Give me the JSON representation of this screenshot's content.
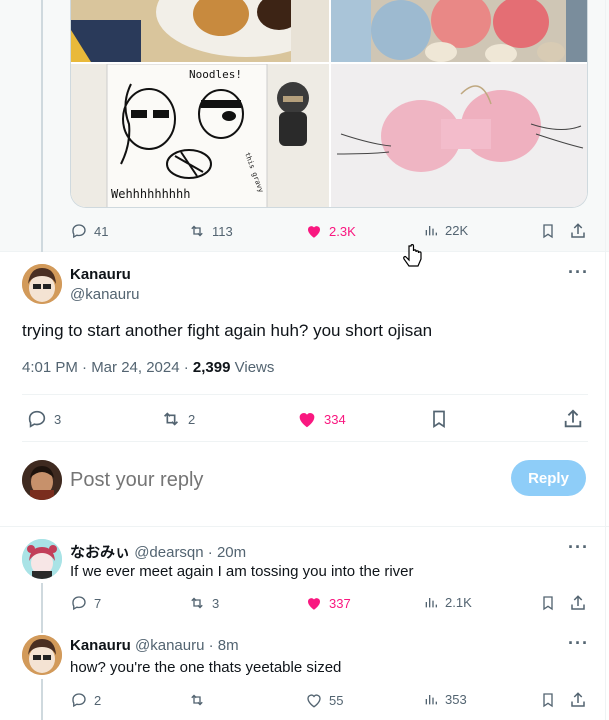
{
  "top_tweet": {
    "actions": {
      "replies": "41",
      "reposts": "113",
      "likes": "2.3K",
      "views": "22K"
    },
    "image_text": {
      "noodles": "Noodles!",
      "weh": "Wehhhhhhhhh",
      "side": "this gravy"
    }
  },
  "main_tweet": {
    "author_name": "Kanauru",
    "author_handle": "@kanauru",
    "text": "trying to start another fight again huh? you short ojisan",
    "time": "4:01 PM · Mar 24, 2024 · ",
    "views_count": "2,399",
    "views_label": " Views",
    "actions": {
      "replies": "3",
      "reposts": "2",
      "likes": "334"
    }
  },
  "reply_box": {
    "placeholder": "Post your reply",
    "button_label": "Reply"
  },
  "replies": [
    {
      "name": "なおみぃ",
      "handle_time": "@dearsqn · 20m",
      "text": "If we ever meet again I am tossing you into the river",
      "replies": "7",
      "reposts": "3",
      "likes": "337",
      "views": "2.1K"
    },
    {
      "name": "Kanauru",
      "handle_time": "@kanauru · 8m",
      "text": "how? you're the one thats yeetable sized",
      "replies": "2",
      "reposts": "",
      "likes": "55",
      "views": "353"
    }
  ],
  "colors": {
    "accent": "#1d9bf0",
    "reply_button_disabled": "#8ecdf8",
    "like": "#f91880",
    "muted": "#536471",
    "border": "#eff3f4"
  },
  "icons": [
    "reply-icon",
    "repost-icon",
    "like-icon",
    "views-icon",
    "bookmark-icon",
    "share-icon",
    "more-icon",
    "cursor-icon"
  ]
}
